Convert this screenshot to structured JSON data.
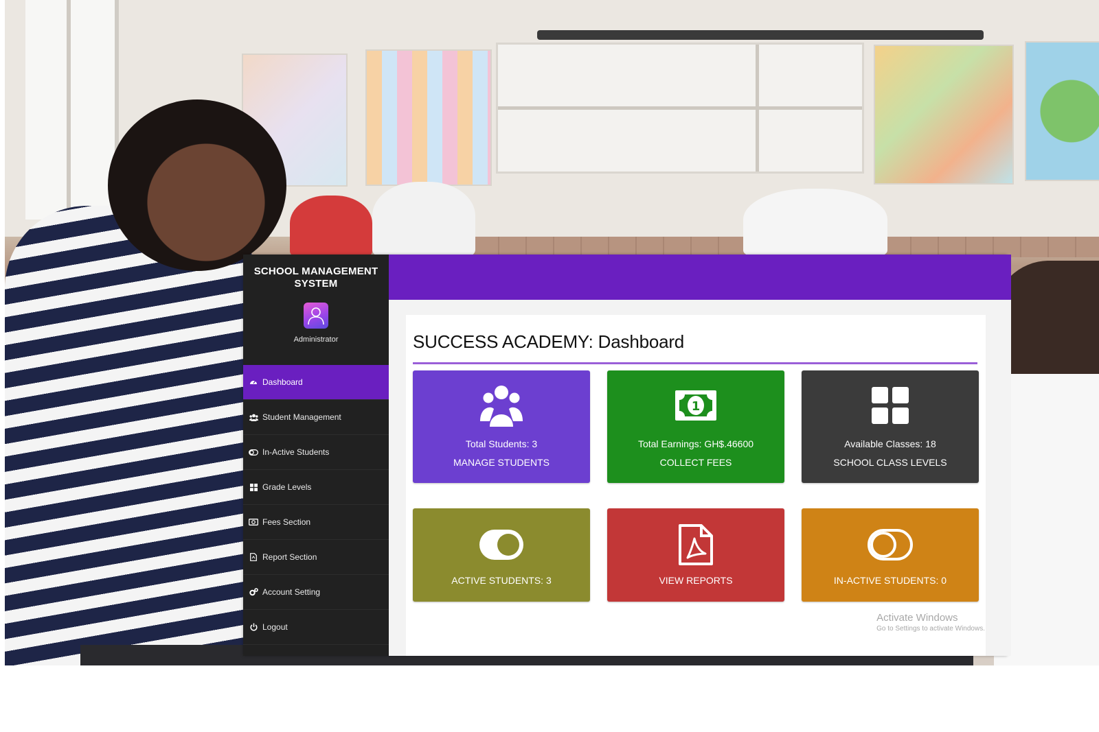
{
  "sidebar": {
    "brand": "SCHOOL MANAGEMENT SYSTEM",
    "role": "Administrator",
    "items": [
      {
        "label": "Dashboard",
        "icon": "dashboard-icon",
        "active": true
      },
      {
        "label": "Student Management",
        "icon": "users-icon",
        "active": false
      },
      {
        "label": "In-Active Students",
        "icon": "toggle-off-icon",
        "active": false
      },
      {
        "label": "Grade Levels",
        "icon": "grid-icon",
        "active": false
      },
      {
        "label": "Fees Section",
        "icon": "money-icon",
        "active": false
      },
      {
        "label": "Report Section",
        "icon": "file-icon",
        "active": false
      },
      {
        "label": "Account Setting",
        "icon": "cogs-icon",
        "active": false
      },
      {
        "label": "Logout",
        "icon": "power-icon",
        "active": false
      }
    ]
  },
  "page": {
    "title": "SUCCESS ACADEMY: Dashboard"
  },
  "tiles": [
    {
      "line1": "Total Students: 3",
      "line2": "MANAGE STUDENTS",
      "icon": "users-icon",
      "color": "#6c3fd0"
    },
    {
      "line1": "Total Earnings: GH$.46600",
      "line2": "COLLECT FEES",
      "icon": "money-bill-icon",
      "color": "#1d8f1d"
    },
    {
      "line1": "Available Classes: 18",
      "line2": "SCHOOL CLASS LEVELS",
      "icon": "th-large-icon",
      "color": "#3b3b3b"
    },
    {
      "line1": "ACTIVE STUDENTS: 3",
      "icon": "toggle-on-icon",
      "color": "#8b8b2e"
    },
    {
      "line1": "VIEW REPORTS",
      "icon": "file-pdf-icon",
      "color": "#c23737"
    },
    {
      "line1": "IN-ACTIVE STUDENTS: 0",
      "icon": "toggle-off-icon",
      "color": "#cf8316"
    }
  ],
  "watermark": {
    "title": "Activate Windows",
    "subtitle": "Go to Settings to activate Windows."
  },
  "colors": {
    "accent": "#6a1fc0",
    "sidebar": "#212121"
  }
}
